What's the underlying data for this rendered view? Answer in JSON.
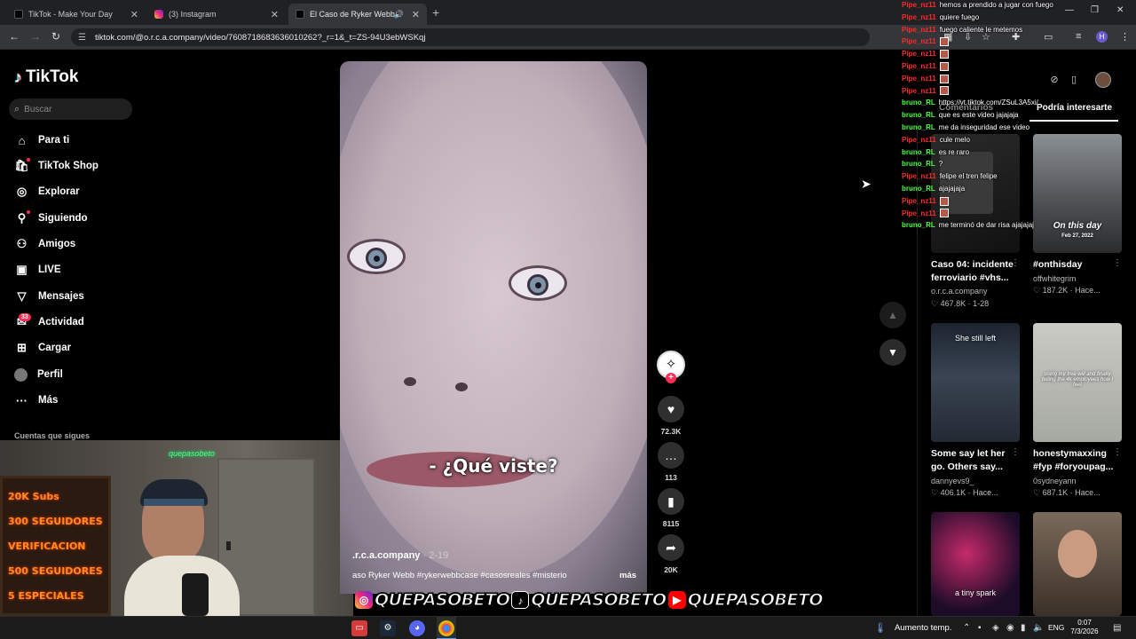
{
  "browser": {
    "tabs": [
      {
        "title": "TikTok - Make Your Day",
        "active": false
      },
      {
        "title": "(3) Instagram",
        "active": false
      },
      {
        "title": "El Caso de Ryker Webb: De",
        "active": true
      }
    ],
    "url": "tiktok.com/@o.r.c.a.company/video/7608718683636010262?_r=1&_t=ZS-94U3ebWSKqj",
    "profile_initial": "H"
  },
  "sidebar": {
    "logo": "TikTok",
    "search_placeholder": "Buscar",
    "items": [
      {
        "label": "Para ti",
        "icon": "home-icon"
      },
      {
        "label": "TikTok Shop",
        "icon": "shop-icon"
      },
      {
        "label": "Explorar",
        "icon": "compass-icon"
      },
      {
        "label": "Siguiendo",
        "icon": "following-icon"
      },
      {
        "label": "Amigos",
        "icon": "friends-icon"
      },
      {
        "label": "LIVE",
        "icon": "live-icon"
      },
      {
        "label": "Mensajes",
        "icon": "messages-icon"
      },
      {
        "label": "Actividad",
        "icon": "activity-icon"
      },
      {
        "label": "Cargar",
        "icon": "upload-icon"
      },
      {
        "label": "Perfil",
        "icon": "profile-avatar"
      },
      {
        "label": "Más",
        "icon": "more-icon"
      }
    ],
    "activity_badge": "33",
    "following_accounts_label": "Cuentas que sigues"
  },
  "webcam": {
    "board_lines": [
      "20K Subs",
      "300 SEGUIDORES",
      "VERIFICACION",
      "500 SEGUIDORES",
      "5 ESPECIALES"
    ],
    "neon_tag": "quepasobeto"
  },
  "video": {
    "subtitle": "- ¿Qué viste?",
    "author": ".r.c.a.company",
    "date": "2-19",
    "description": "aso Ryker Webb #rykerwebbcase #casosreales #misterio",
    "more_label": "más",
    "likes": "72.3K",
    "comments": "113",
    "saves": "8115",
    "shares": "20K"
  },
  "right_panel": {
    "tab_comments": "Comentarios",
    "tab_suggested": "Podría interesarte",
    "cards": [
      {
        "title": "Caso 04: incidente ferroviario #vhs...",
        "user": "o.r.c.a.company",
        "meta": "♡ 467.8K · 1-28",
        "thumb_text": "",
        "thumb_sub": ""
      },
      {
        "title": "#onthisday",
        "user": "offwhitegrim",
        "meta": "♡ 187.2K · Hace...",
        "thumb_text": "On this day",
        "thumb_sub": "Feb 27, 2022"
      },
      {
        "title": "Some say let her go. Others say...",
        "user": "dannyevs9_",
        "meta": "♡ 406.1K · Hace...",
        "thumb_text": "She still left",
        "thumb_sub": ""
      },
      {
        "title": "honestymaxxing #fyp #foryoupag...",
        "user": "0sydneyann",
        "meta": "♡ 687.1K · Hace...",
        "thumb_text": "using my tree will and finally telling the 4k employees how i feel",
        "thumb_sub": ""
      },
      {
        "title": "",
        "user": "",
        "meta": "",
        "thumb_text": "a tiny spark",
        "thumb_sub": ""
      },
      {
        "title": "",
        "user": "",
        "meta": "",
        "thumb_text": "",
        "thumb_sub": ""
      }
    ]
  },
  "chat": [
    {
      "user": "Pipe_nz11",
      "msg": "hemos a prendido a jugar con fuego",
      "kind": "pipe"
    },
    {
      "user": "Pipe_nz11",
      "msg": "quiere fuego",
      "kind": "pipe"
    },
    {
      "user": "Pipe_nz11",
      "msg": "fuego caliente le metemos",
      "kind": "pipe"
    },
    {
      "user": "Pipe_nz11",
      "msg": "",
      "kind": "pipe",
      "emote": true
    },
    {
      "user": "Pipe_nz11",
      "msg": "",
      "kind": "pipe",
      "emote": true
    },
    {
      "user": "Pipe_nz11",
      "msg": "",
      "kind": "pipe",
      "emote": true
    },
    {
      "user": "Pipe_nz11",
      "msg": "",
      "kind": "pipe",
      "emote": true
    },
    {
      "user": "Pipe_nz11",
      "msg": "",
      "kind": "pipe",
      "emote": true
    },
    {
      "user": "bruno_RL",
      "msg": "https://vt.tiktok.com/ZSuL3A5xi/",
      "kind": "bruno"
    },
    {
      "user": "bruno_RL",
      "msg": "que es este video jajajaja",
      "kind": "bruno"
    },
    {
      "user": "bruno_RL",
      "msg": "me da inseguridad ese video",
      "kind": "bruno"
    },
    {
      "user": "Pipe_nz11",
      "msg": "cule melo",
      "kind": "pipe"
    },
    {
      "user": "bruno_RL",
      "msg": "es re raro",
      "kind": "bruno"
    },
    {
      "user": "bruno_RL",
      "msg": "?",
      "kind": "bruno"
    },
    {
      "user": "Pipe_nz11",
      "msg": "felipe el tren felipe",
      "kind": "pipe"
    },
    {
      "user": "bruno_RL",
      "msg": "ajajajaja",
      "kind": "bruno"
    },
    {
      "user": "Pipe_nz11",
      "msg": "",
      "kind": "pipe",
      "emote": true
    },
    {
      "user": "Pipe_nz11",
      "msg": "",
      "kind": "pipe",
      "emote": true
    },
    {
      "user": "bruno_RL",
      "msg": "me terminó de dar risa ajajajaj",
      "kind": "bruno"
    }
  ],
  "banner": {
    "items": [
      {
        "platform": "instagram-icon",
        "handle": "QUEPASOBETO"
      },
      {
        "platform": "tiktok-icon",
        "handle": "QUEPASOBETO"
      },
      {
        "platform": "youtube-icon",
        "handle": "QUEPASOBETO"
      }
    ]
  },
  "taskbar": {
    "weather": "Aumento temp.",
    "language": "ENG",
    "time": "0:07",
    "date": "7/3/2026"
  },
  "colors": {
    "accent": "#fe2c55",
    "chat_pipe": "#ff2a2a",
    "chat_bruno": "#47ff3a"
  }
}
